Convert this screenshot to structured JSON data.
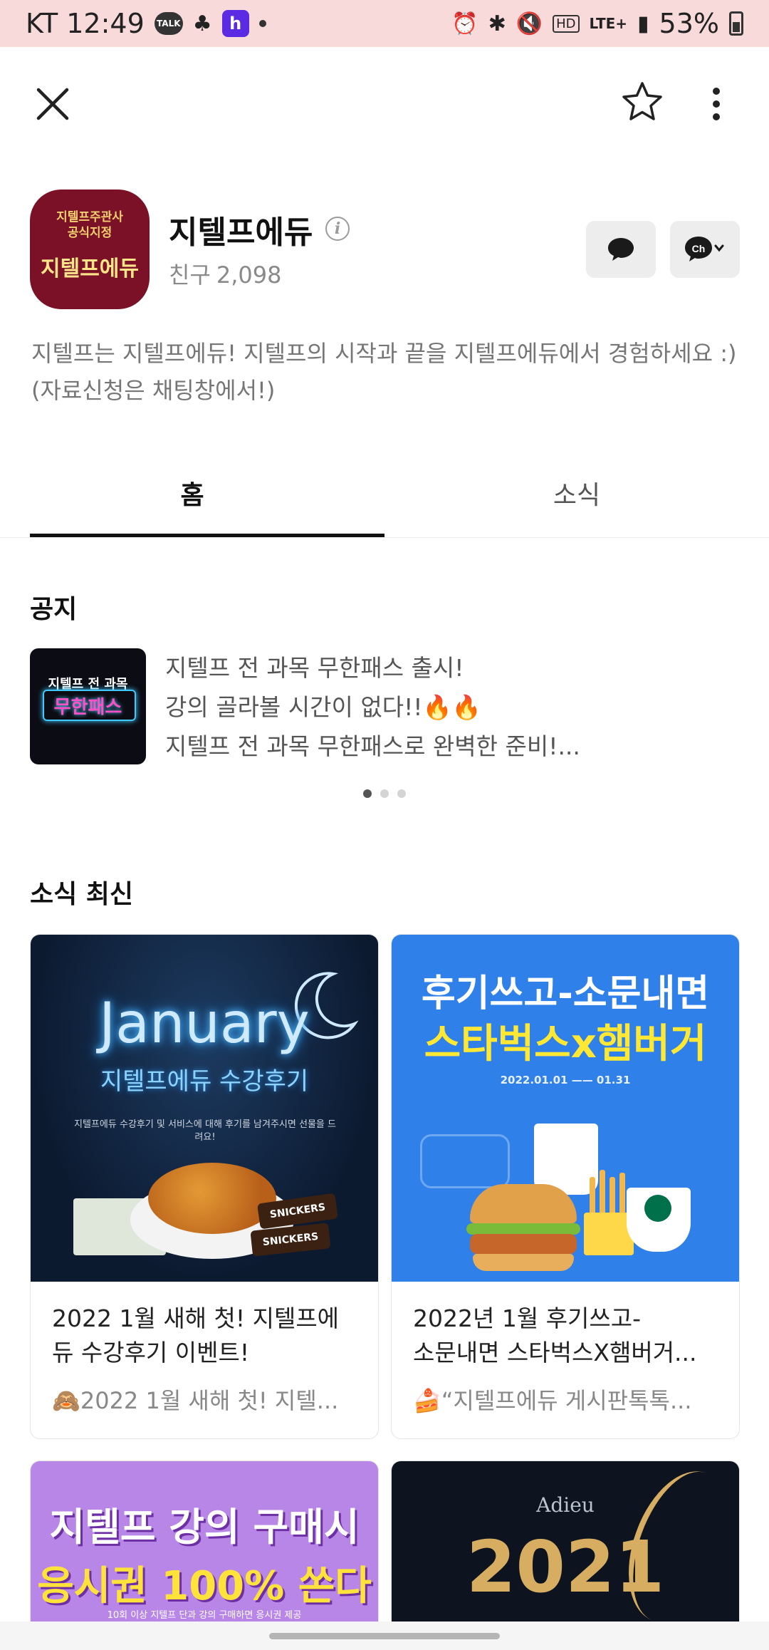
{
  "status_bar": {
    "carrier_time": "KT 12:49",
    "talk_badge": "TALK",
    "h_badge": "h",
    "network": "LTE+",
    "battery": "53%",
    "icons": [
      "talk-icon",
      "tree-icon",
      "h-app-icon",
      "dot-icon",
      "alarm-icon",
      "bluetooth-icon",
      "mute-icon",
      "hd-icon",
      "lte-icon",
      "signal-icon",
      "battery-icon"
    ]
  },
  "profile": {
    "avatar_top_line1": "지텔프주관사",
    "avatar_top_line2": "공식지정",
    "avatar_main": "지텔프에듀",
    "name": "지텔프에듀",
    "friends_label": "친구",
    "friends_count": "2,098",
    "description_line1": "지텔프는 지텔프에듀! 지텔프의 시작과 끝을 지텔프에듀에서 경험하세요 :)",
    "description_line2": "(자료신청은 채팅창에서!)"
  },
  "tabs": [
    {
      "label": "홈",
      "active": true
    },
    {
      "label": "소식",
      "active": false
    }
  ],
  "notice": {
    "section_title": "공지",
    "thumb_line1": "지텔프 전 과목",
    "thumb_line2": "무한패스",
    "line1": "지텔프 전 과목 무한패스 출시!",
    "line2": "강의 골라볼 시간이 없다!!🔥🔥",
    "line3": "지텔프 전 과목 무한패스로 완벽한 준비!...",
    "page_count": 3,
    "active_page": 1
  },
  "news": {
    "section_title": "소식 최신",
    "cards": [
      {
        "img_word": "January",
        "img_sub": "지텔프에듀 수강후기",
        "img_small": "지텔프에듀 수강후기 및 서비스에 대해 후기를 남겨주시면 선물을 드려요!",
        "bar_text": "SNICKERS",
        "title_line1": "2022 1월 새해 첫! 지텔프에",
        "title_line2": "듀 수강후기 이벤트!",
        "subtitle": "🙈2022 1월 새해 첫! 지텔..."
      },
      {
        "img_line1": "후기쓰고-소문내면",
        "img_line2": "스타벅스x햄버거",
        "img_date": "2022.01.01 —— 01.31",
        "title_line1": "2022년 1월 후기쓰고-",
        "title_line2": "소문내면 스타벅스X햄버거...",
        "subtitle": "🍰“지텔프에듀 게시판톡톡..."
      },
      {
        "img_line1": "지텔프 강의 구매시",
        "img_line2": "응시권 100% 쏜다",
        "img_line3": "10회 이상 지텔프 단과 강의 구매하면 응시권 제공"
      },
      {
        "img_line1": "Adieu",
        "img_line2": "2021"
      }
    ]
  },
  "colors": {
    "status_bar_bg": "#f9dadb",
    "avatar_bg": "#7a1126",
    "card2_bg": "#2f80e8",
    "card3_bg": "#b886e6",
    "card4_bg": "#0d1420"
  }
}
